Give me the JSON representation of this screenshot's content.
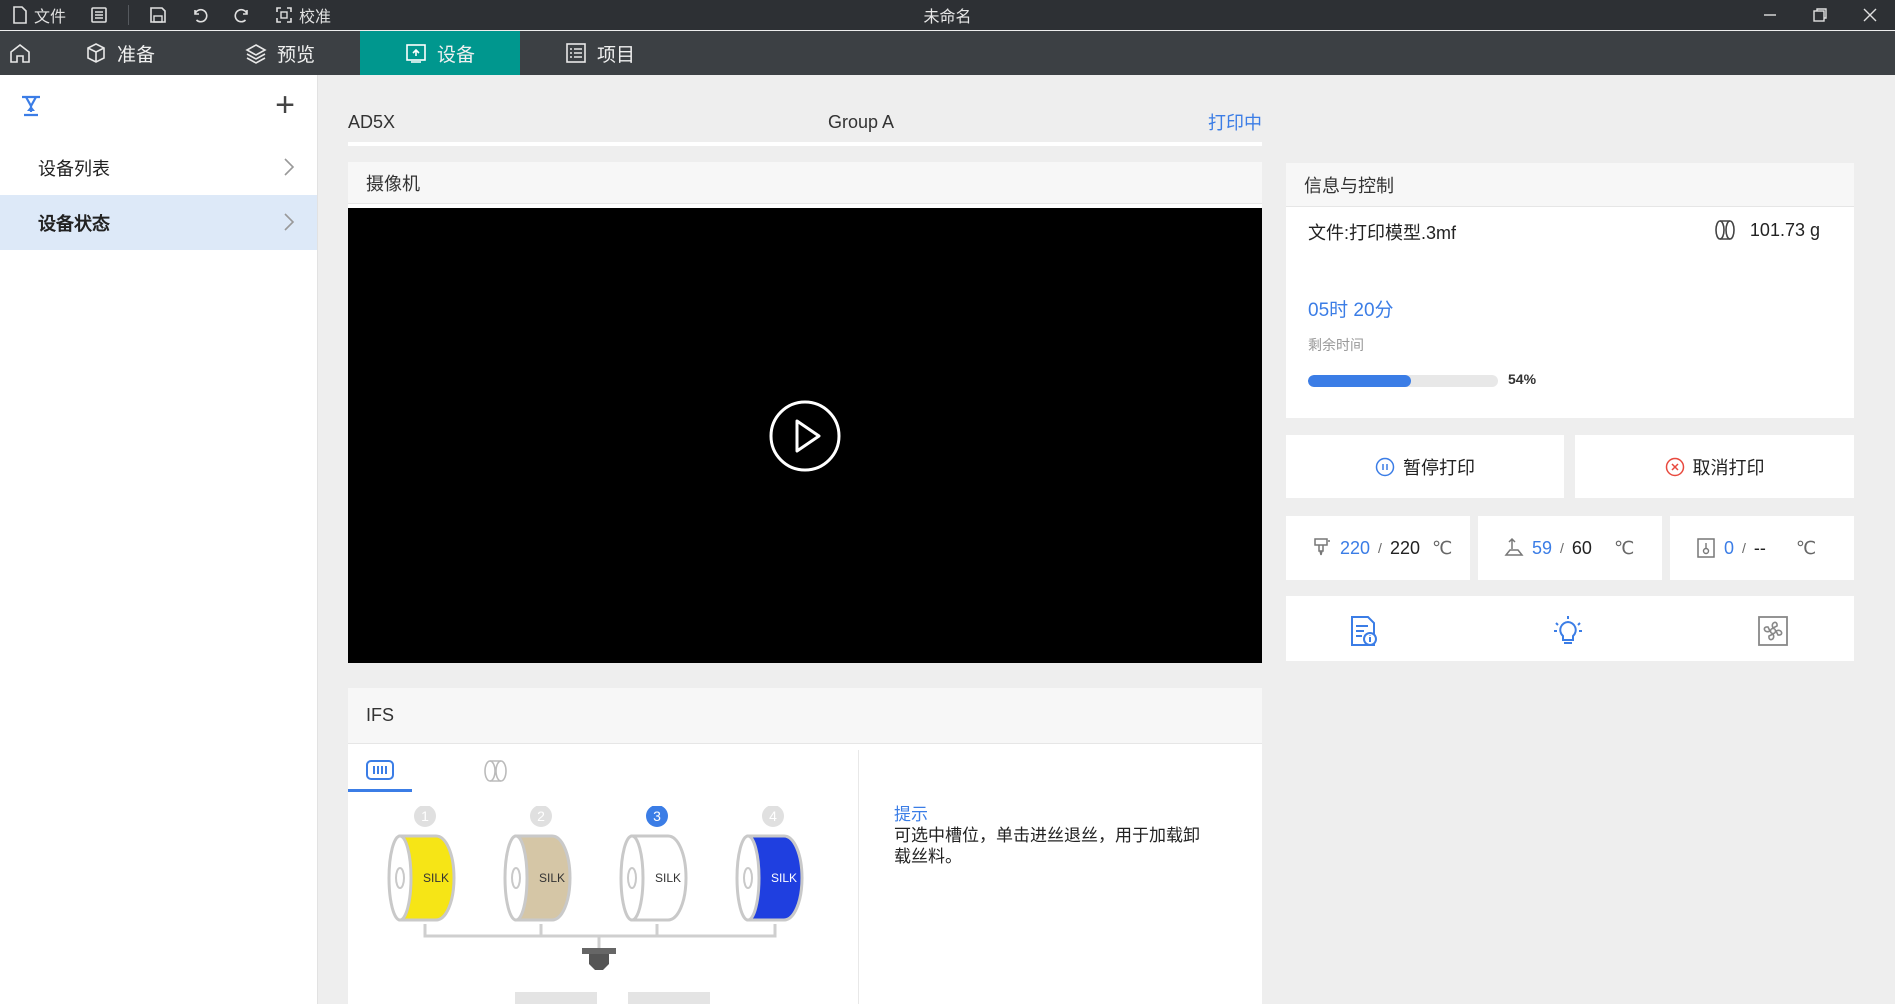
{
  "titlebar": {
    "file_label": "文件",
    "calibrate_label": "校准",
    "title": "未命名"
  },
  "nav": {
    "tabs": [
      {
        "label": "准备"
      },
      {
        "label": "预览"
      },
      {
        "label": "设备"
      },
      {
        "label": "项目"
      }
    ]
  },
  "sidebar": {
    "items": [
      {
        "label": "设备列表"
      },
      {
        "label": "设备状态"
      }
    ]
  },
  "device": {
    "name": "AD5X",
    "group": "Group A",
    "status": "打印中"
  },
  "camera": {
    "title": "摄像机"
  },
  "ifs": {
    "title": "IFS",
    "slots": [
      {
        "number": "1",
        "label": "SILK",
        "color": "#f6e516"
      },
      {
        "number": "2",
        "label": "SILK",
        "color": "#d5c6a6"
      },
      {
        "number": "3",
        "label": "SILK",
        "color": "#ffffff"
      },
      {
        "number": "4",
        "label": "SILK",
        "color": "#1f3fe0"
      }
    ],
    "selected_slot": "3",
    "tip_title": "提示",
    "tip_text": "可选中槽位，单击进丝退丝，用于加载卸载丝料。"
  },
  "info": {
    "title": "信息与控制",
    "file": "文件:打印模型.3mf",
    "weight": "101.73 g",
    "time_remaining": "05时 20分",
    "remaining_label": "剩余时间",
    "progress_percent": 54,
    "progress_text": "54%"
  },
  "controls": {
    "pause_label": "暂停打印",
    "cancel_label": "取消打印"
  },
  "temps": {
    "nozzle": {
      "current": "220",
      "sep": "/",
      "target": "220",
      "unit": "℃"
    },
    "bed": {
      "current": "59",
      "sep": "/",
      "target": "60",
      "unit": "℃"
    },
    "chamber": {
      "current": "0",
      "sep": "/",
      "target": "--",
      "unit": "℃"
    }
  },
  "colors": {
    "accent": "#3b7de6",
    "nav_active": "#00978e"
  }
}
